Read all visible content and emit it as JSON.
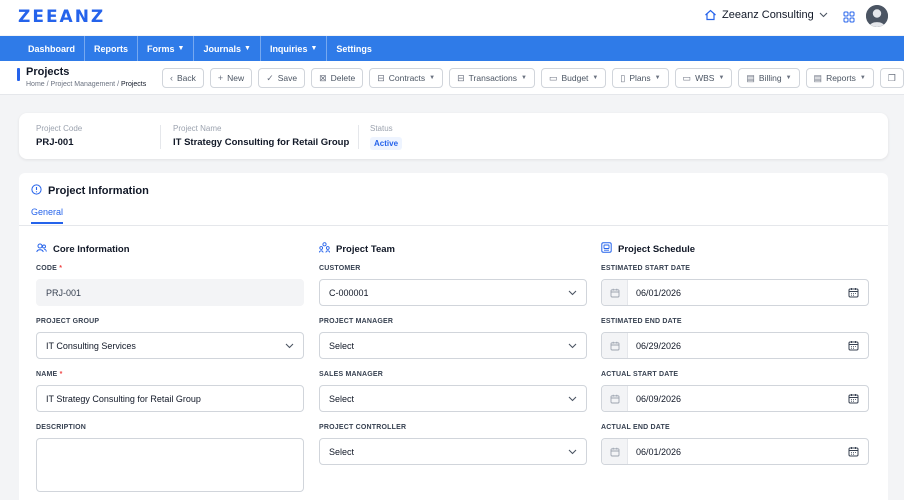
{
  "app": {
    "logo": "ZEEANZ",
    "company": "Zeeanz Consulting"
  },
  "nav": [
    {
      "label": "Dashboard",
      "has_menu": false
    },
    {
      "label": "Reports",
      "has_menu": false
    },
    {
      "label": "Forms",
      "has_menu": true
    },
    {
      "label": "Journals",
      "has_menu": true
    },
    {
      "label": "Inquiries",
      "has_menu": true
    },
    {
      "label": "Settings",
      "has_menu": false
    }
  ],
  "page": {
    "title": "Projects",
    "breadcrumb": [
      "Home",
      "Project Management",
      "Projects"
    ]
  },
  "toolbar": [
    {
      "label": "Back",
      "icon": "chevron-left-icon",
      "has_menu": false
    },
    {
      "label": "New",
      "icon": "plus-icon",
      "has_menu": false
    },
    {
      "label": "Save",
      "icon": "check-icon",
      "has_menu": false
    },
    {
      "label": "Delete",
      "icon": "x-box-icon",
      "has_menu": false
    },
    {
      "label": "Contracts",
      "icon": "contract-icon",
      "has_menu": true
    },
    {
      "label": "Transactions",
      "icon": "transactions-icon",
      "has_menu": true
    },
    {
      "label": "Budget",
      "icon": "folder-icon",
      "has_menu": true
    },
    {
      "label": "Plans",
      "icon": "plans-icon",
      "has_menu": true
    },
    {
      "label": "WBS",
      "icon": "wbs-icon",
      "has_menu": true
    },
    {
      "label": "Billing",
      "icon": "billing-icon",
      "has_menu": true
    },
    {
      "label": "Reports",
      "icon": "reports-icon",
      "has_menu": true
    }
  ],
  "summary": {
    "code_label": "Project Code",
    "code_value": "PRJ-001",
    "name_label": "Project Name",
    "name_value": "IT Strategy Consulting for Retail Group",
    "status_label": "Status",
    "status_value": "Active"
  },
  "panel": {
    "title": "Project Information",
    "tab": "General",
    "core": {
      "title": "Core Information",
      "code_label": "CODE",
      "code_value": "PRJ-001",
      "group_label": "PROJECT GROUP",
      "group_value": "IT Consulting Services",
      "name_label": "NAME",
      "name_value": "IT Strategy Consulting for Retail Group",
      "desc_label": "DESCRIPTION",
      "desc_value": ""
    },
    "team": {
      "title": "Project Team",
      "customer_label": "CUSTOMER",
      "customer_value": "C-000001",
      "pm_label": "PROJECT MANAGER",
      "pm_value": "Select",
      "sm_label": "SALES MANAGER",
      "sm_value": "Select",
      "pc_label": "PROJECT CONTROLLER",
      "pc_value": "Select"
    },
    "schedule": {
      "title": "Project Schedule",
      "est_start_label": "ESTIMATED START DATE",
      "est_start_value": "06/01/2026",
      "est_end_label": "ESTIMATED END DATE",
      "est_end_value": "06/29/2026",
      "act_start_label": "ACTUAL START DATE",
      "act_start_value": "06/09/2026",
      "act_end_label": "ACTUAL END DATE",
      "act_end_value": "06/01/2026"
    }
  },
  "colors": {
    "brand": "#2563eb",
    "nav": "#2f7be8",
    "required": "#ef4444"
  }
}
